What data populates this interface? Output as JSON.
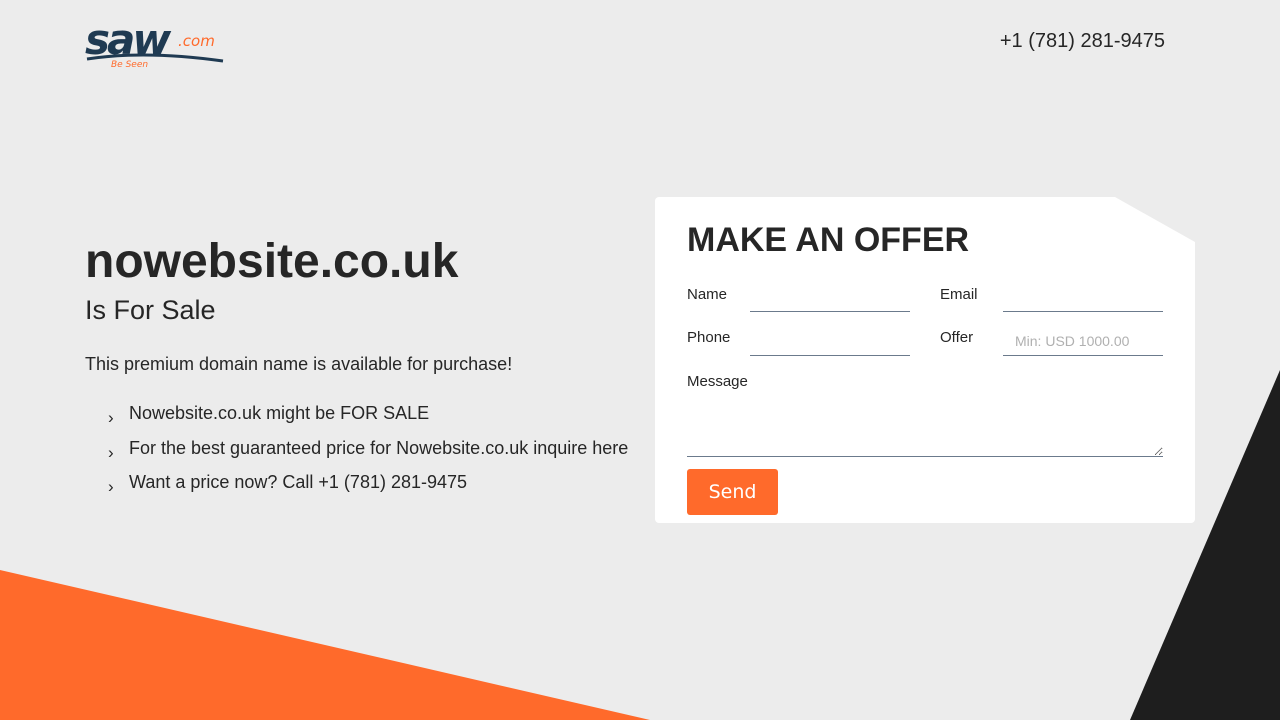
{
  "header": {
    "logo_text": "saw",
    "logo_suffix": ".com",
    "logo_tagline": "Be Seen",
    "phone": "+1 (781) 281-9475"
  },
  "main": {
    "domain": "nowebsite.co.uk",
    "subtitle": "Is For Sale",
    "intro": "This premium domain name is available for purchase!",
    "bullets": [
      "Nowebsite.co.uk might be FOR SALE",
      "For the best guaranteed price for Nowebsite.co.uk inquire here",
      "Want a price now? Call +1 (781) 281-9475"
    ]
  },
  "offer_form": {
    "title": "MAKE AN OFFER",
    "name_label": "Name",
    "email_label": "Email",
    "phone_label": "Phone",
    "offer_label": "Offer",
    "offer_placeholder": "Min: USD 1000.00",
    "message_label": "Message",
    "send_label": "Send"
  },
  "colors": {
    "accent": "#ff6a2b",
    "dark": "#1e1e1e",
    "logo_navy": "#1f3a52",
    "background": "#ececec"
  }
}
